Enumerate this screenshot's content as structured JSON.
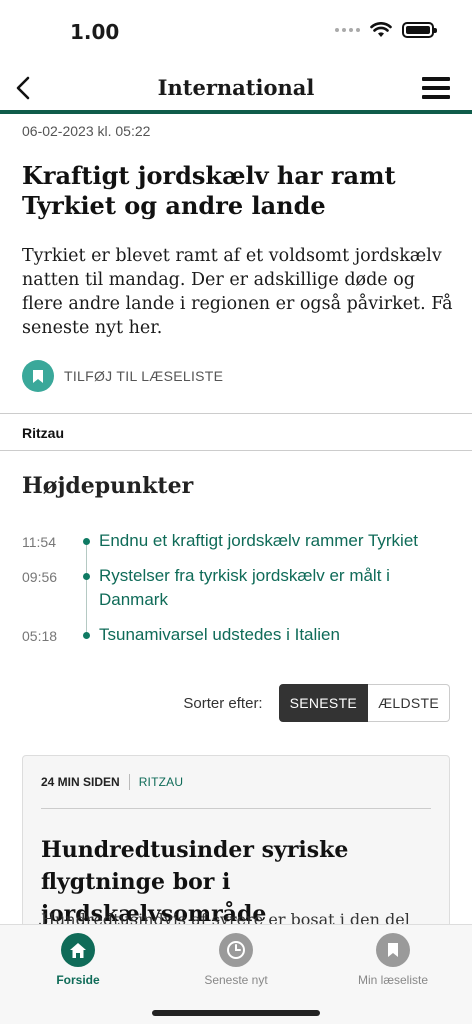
{
  "status": {
    "time": "1.00"
  },
  "nav": {
    "title": "International"
  },
  "article": {
    "date": "06-02-2023 kl. 05:22",
    "title": "Kraftigt jordskælv har ramt Tyrkiet og andre lande",
    "lead": "Tyrkiet er blevet ramt af et voldsomt jordskælv natten til mandag. Der er adskillige døde og flere andre lande i regionen er også påvirket. Få seneste nyt her.",
    "add_to_readlist": "TILFØJ TIL LÆSELISTE",
    "source": "Ritzau"
  },
  "highlights": {
    "heading": "Højdepunkter",
    "items": [
      {
        "time": "11:54",
        "text": "Endnu et kraftigt jordskælv rammer Tyrkiet"
      },
      {
        "time": "09:56",
        "text": "Rystelser fra tyrkisk jordskælv er målt i Danmark"
      },
      {
        "time": "05:18",
        "text": "Tsunamivarsel udstedes i Italien"
      }
    ]
  },
  "sort": {
    "label": "Sorter efter:",
    "newest": "SENESTE",
    "oldest": "ÆLDSTE",
    "selected": "SENESTE"
  },
  "card": {
    "ago": "24 MIN SIDEN",
    "source": "RITZAU",
    "title": "Hundredtusinder syriske flygtninge bor i jordskælvsområde",
    "snippet": "Hundredtusindvis af syrere er bosat i den del"
  },
  "tabs": [
    {
      "label": "Forside",
      "icon": "home-icon",
      "active": true
    },
    {
      "label": "Seneste nyt",
      "icon": "clock-icon",
      "active": false
    },
    {
      "label": "Min læseliste",
      "icon": "bookmark-icon",
      "active": false
    }
  ],
  "colors": {
    "accent": "#0f6b58",
    "readlist": "#3aa89a",
    "nav_rule": "#0f5c4a"
  }
}
